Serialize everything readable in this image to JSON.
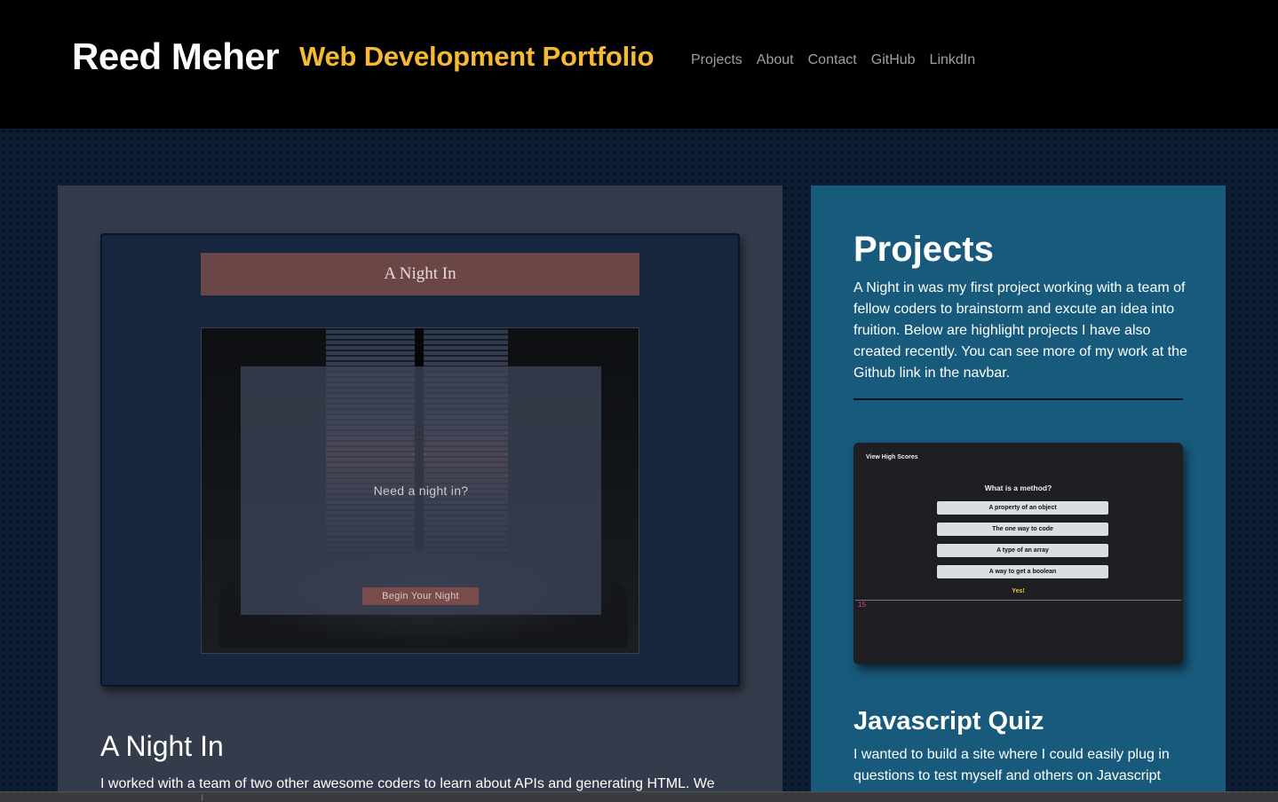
{
  "header": {
    "brand": "Reed Meher",
    "tagline": "Web Development Portfolio",
    "nav": [
      "Projects",
      "About",
      "Contact",
      "GitHub",
      "LinkdIn"
    ]
  },
  "colors": {
    "header_bg": "#000000",
    "tagline": "#f5b935",
    "left_card_bg": "#343b4a",
    "right_card_bg": "#175a7c"
  },
  "featured_project": {
    "screenshot": {
      "banner_title": "A Night In",
      "question": "Need a night in?",
      "button_label": "Begin Your Night"
    },
    "title": "A Night In",
    "description": "I worked with a team of two other awesome coders to learn about APIs and generating HTML. We"
  },
  "sidebar": {
    "heading": "Projects",
    "intro": "A Night in was my first project working with a team of fellow coders to brainstorm and excute an idea into fruition. Below are highlight projects I have also created recently. You can see more of my work at the Github link in the navbar.",
    "quiz_screenshot": {
      "high_scores": "View High Scores",
      "question": "What is a method?",
      "options": [
        "A property of an object",
        "The one way to code",
        "A type of an array",
        "A way to get a boolean"
      ],
      "feedback": "Yes!",
      "timer": "15"
    },
    "quiz_title": "Javascript Quiz",
    "quiz_description": "I wanted to build a site where I could easily plug in questions to test myself and others on Javascript"
  }
}
